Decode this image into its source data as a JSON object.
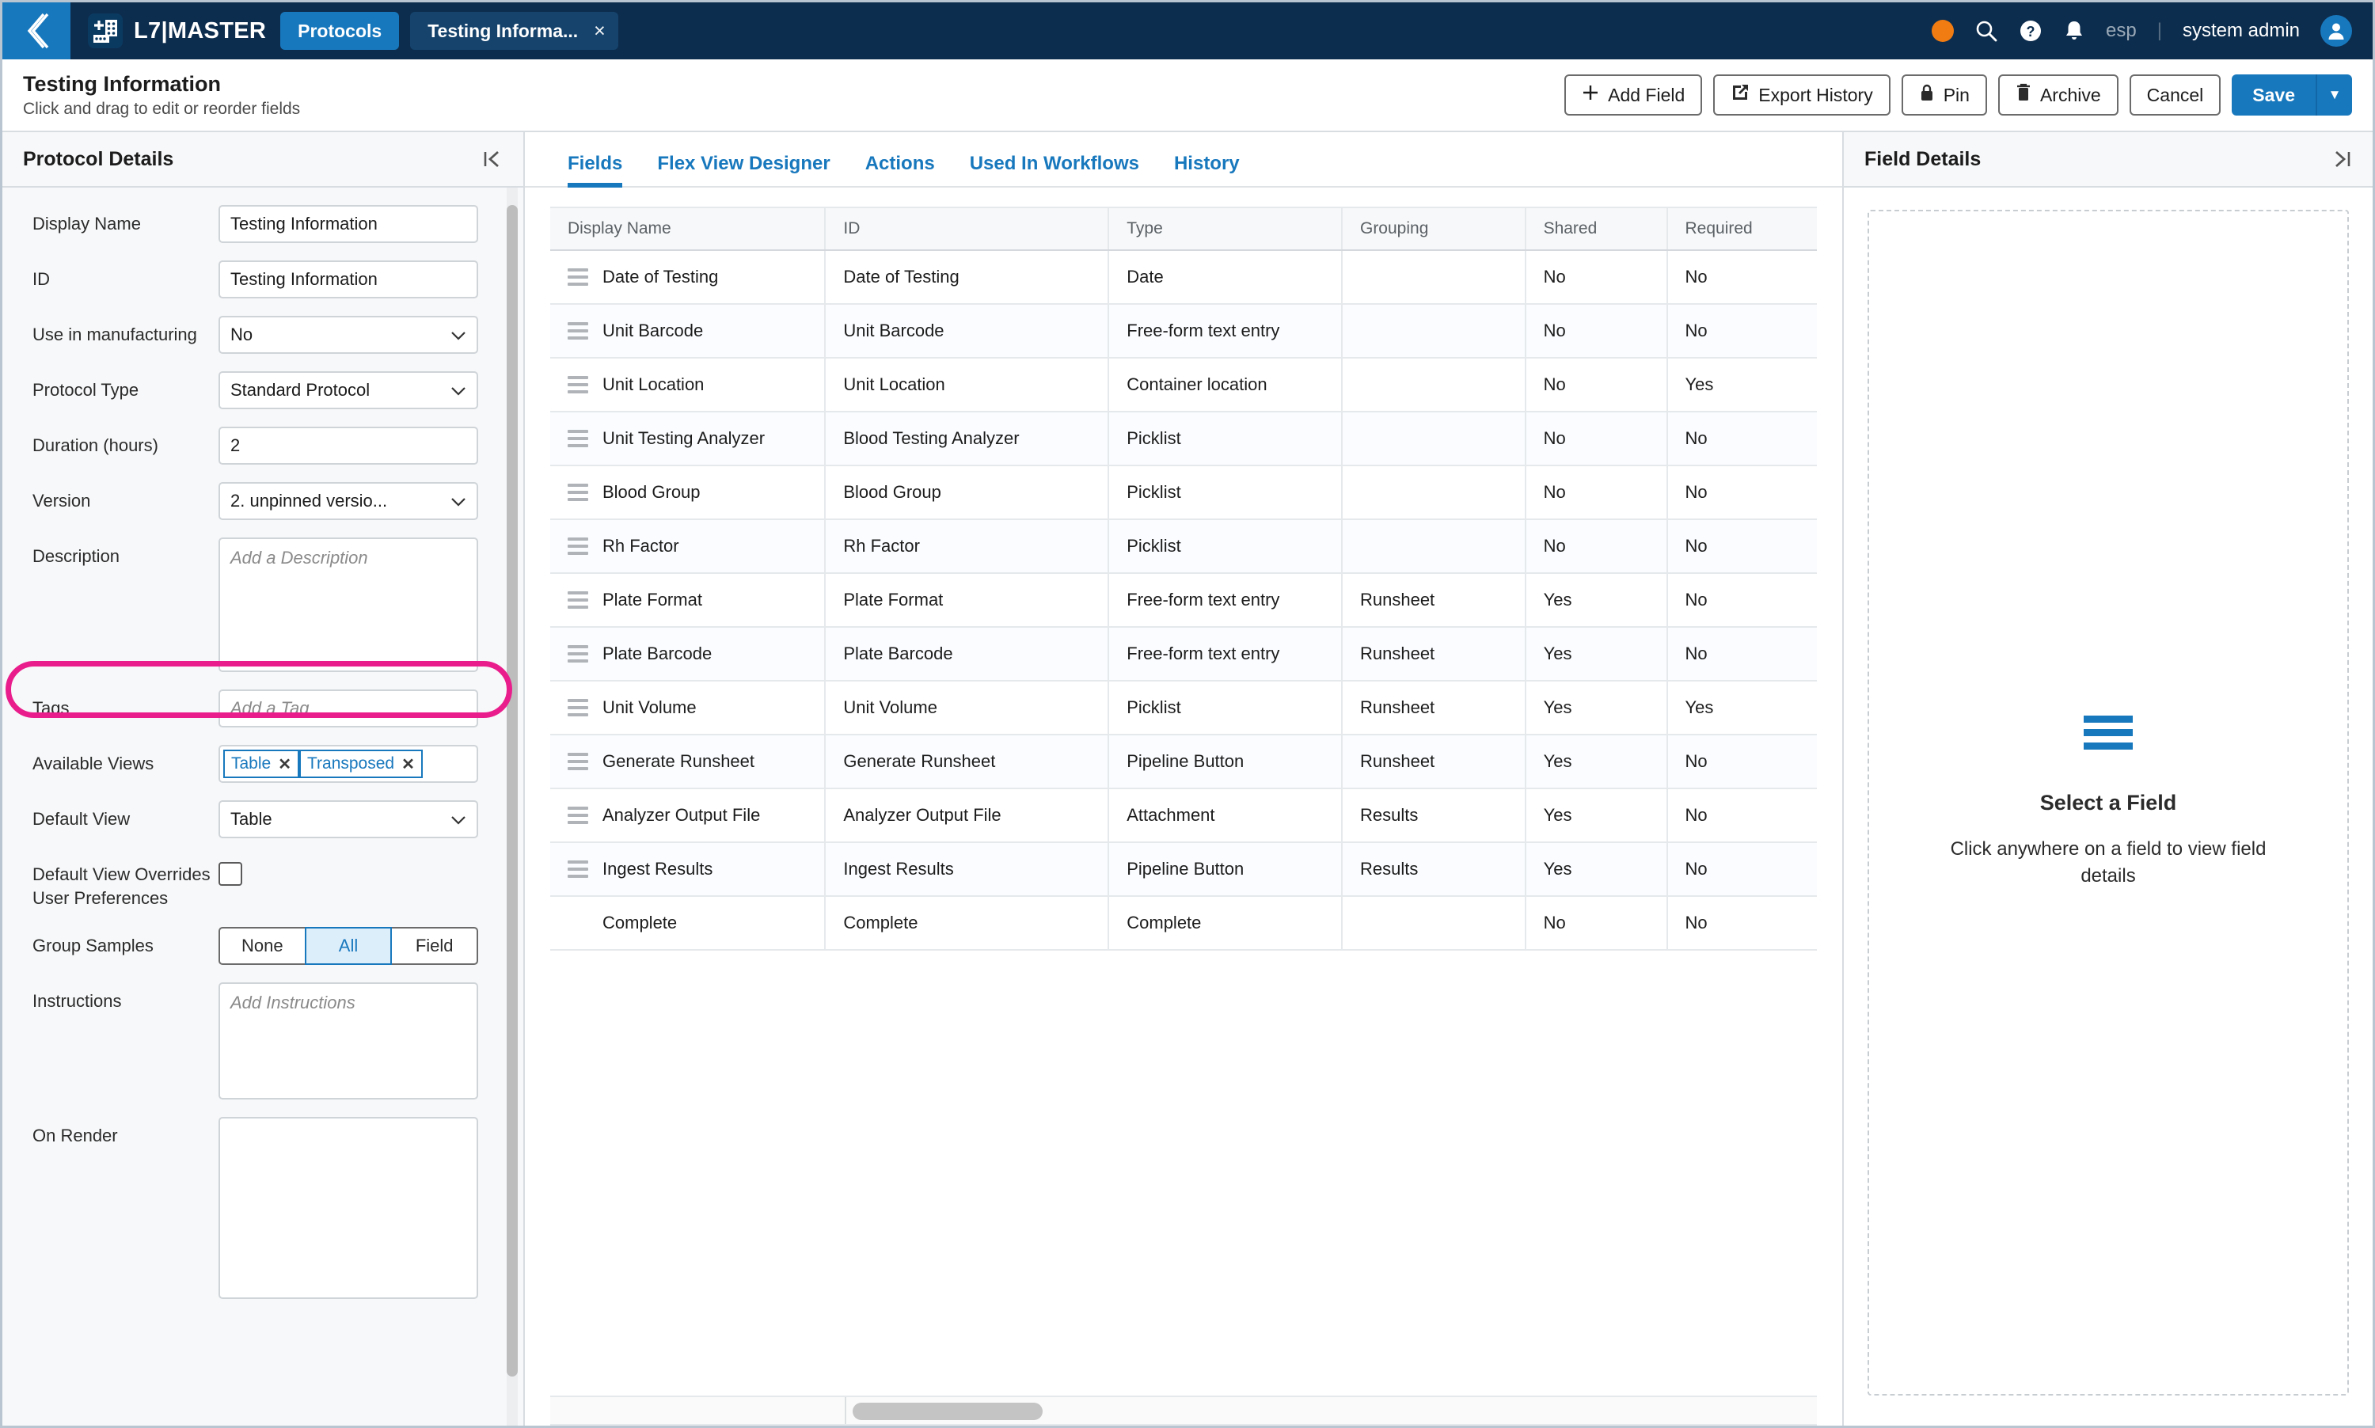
{
  "topnav": {
    "back_icon": "back-chevron-icon",
    "logo_icon": "l7-plate-logo-icon",
    "brand": "L7|MASTER",
    "tabs": [
      {
        "label": "Protocols",
        "active": true,
        "closable": false
      },
      {
        "label": "Testing Informa...",
        "active": false,
        "closable": true,
        "close": "×"
      }
    ],
    "status_dot_color": "#f07c12",
    "search_icon": "search-icon",
    "help_icon": "help-circle-icon",
    "bell_icon": "notification-bell-icon",
    "tenant": "esp",
    "divider": "|",
    "user": "system admin",
    "avatar_icon": "user-avatar-icon"
  },
  "toolbar": {
    "title": "Testing Information",
    "subtitle": "Click and drag to edit or reorder fields",
    "add_field": "Add Field",
    "export_history": "Export History",
    "pin": "Pin",
    "archive": "Archive",
    "cancel": "Cancel",
    "save": "Save",
    "save_caret": "▼"
  },
  "left_panel": {
    "header": "Protocol Details",
    "collapse_icon": "collapse-left-icon",
    "fields": {
      "display_name_label": "Display Name",
      "display_name_value": "Testing Information",
      "id_label": "ID",
      "id_value": "Testing Information",
      "use_in_manufacturing_label": "Use in manufacturing",
      "use_in_manufacturing_value": "No",
      "protocol_type_label": "Protocol Type",
      "protocol_type_value": "Standard Protocol",
      "duration_label": "Duration (hours)",
      "duration_value": "2",
      "version_label": "Version",
      "version_value": "2. unpinned versio...",
      "description_label": "Description",
      "description_placeholder": "Add a Description",
      "tags_label": "Tags",
      "tags_placeholder": "Add a Tag",
      "available_views_label": "Available Views",
      "available_views_chips": [
        "Table",
        "Transposed"
      ],
      "chip_remove": "✕",
      "default_view_label": "Default View",
      "default_view_value": "Table",
      "default_view_overrides_label": "Default View Overrides User Preferences",
      "default_view_overrides_checked": false,
      "group_samples_label": "Group Samples",
      "group_samples_options": [
        "None",
        "All",
        "Field"
      ],
      "group_samples_selected": "All",
      "instructions_label": "Instructions",
      "instructions_placeholder": "Add Instructions",
      "on_render_label": "On Render",
      "on_render_value": ""
    },
    "highlight_color": "#e91e8c"
  },
  "center_panel": {
    "tabs": [
      {
        "label": "Fields",
        "active": true
      },
      {
        "label": "Flex View Designer",
        "active": false
      },
      {
        "label": "Actions",
        "active": false
      },
      {
        "label": "Used In Workflows",
        "active": false
      },
      {
        "label": "History",
        "active": false
      }
    ],
    "table": {
      "columns": [
        "Display Name",
        "ID",
        "Type",
        "Grouping",
        "Shared",
        "Required"
      ],
      "rows": [
        {
          "display_name": "Date of Testing",
          "id": "Date of Testing",
          "type": "Date",
          "grouping": "",
          "shared": "No",
          "required": "No",
          "draggable": true
        },
        {
          "display_name": "Unit Barcode",
          "id": "Unit Barcode",
          "type": "Free-form text entry",
          "grouping": "",
          "shared": "No",
          "required": "No",
          "draggable": true
        },
        {
          "display_name": "Unit Location",
          "id": "Unit Location",
          "type": "Container location",
          "grouping": "",
          "shared": "No",
          "required": "Yes",
          "draggable": true
        },
        {
          "display_name": "Unit Testing Analyzer",
          "id": "Blood Testing Analyzer",
          "type": "Picklist",
          "grouping": "",
          "shared": "No",
          "required": "No",
          "draggable": true
        },
        {
          "display_name": "Blood Group",
          "id": "Blood Group",
          "type": "Picklist",
          "grouping": "",
          "shared": "No",
          "required": "No",
          "draggable": true
        },
        {
          "display_name": "Rh Factor",
          "id": "Rh Factor",
          "type": "Picklist",
          "grouping": "",
          "shared": "No",
          "required": "No",
          "draggable": true
        },
        {
          "display_name": "Plate Format",
          "id": "Plate Format",
          "type": "Free-form text entry",
          "grouping": "Runsheet",
          "shared": "Yes",
          "required": "No",
          "draggable": true
        },
        {
          "display_name": "Plate Barcode",
          "id": "Plate Barcode",
          "type": "Free-form text entry",
          "grouping": "Runsheet",
          "shared": "Yes",
          "required": "No",
          "draggable": true
        },
        {
          "display_name": "Unit Volume",
          "id": "Unit Volume",
          "type": "Picklist",
          "grouping": "Runsheet",
          "shared": "Yes",
          "required": "Yes",
          "draggable": true
        },
        {
          "display_name": "Generate Runsheet",
          "id": "Generate Runsheet",
          "type": "Pipeline Button",
          "grouping": "Runsheet",
          "shared": "Yes",
          "required": "No",
          "draggable": true
        },
        {
          "display_name": "Analyzer Output File",
          "id": "Analyzer Output File",
          "type": "Attachment",
          "grouping": "Results",
          "shared": "Yes",
          "required": "No",
          "draggable": true
        },
        {
          "display_name": "Ingest Results",
          "id": "Ingest Results",
          "type": "Pipeline Button",
          "grouping": "Results",
          "shared": "Yes",
          "required": "No",
          "draggable": true
        },
        {
          "display_name": "Complete",
          "id": "Complete",
          "type": "Complete",
          "grouping": "",
          "shared": "No",
          "required": "No",
          "draggable": false
        }
      ]
    }
  },
  "right_panel": {
    "header": "Field Details",
    "expand_icon": "collapse-right-icon",
    "empty_icon": "stack-lines-icon",
    "empty_title": "Select a Field",
    "empty_subtitle": "Click anywhere on a field to view field details"
  }
}
